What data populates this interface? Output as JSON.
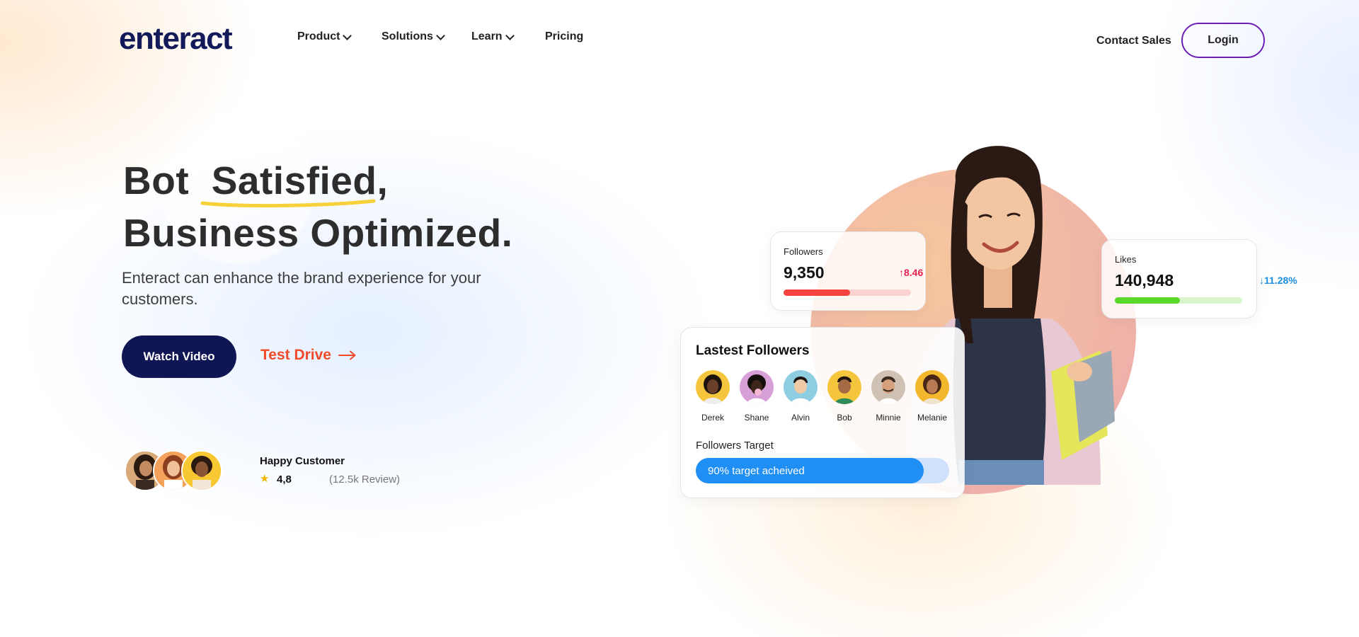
{
  "brand": {
    "logo_text": "enteract",
    "logo_color": "#131a5a"
  },
  "nav": {
    "items": [
      {
        "label": "Product",
        "has_dropdown": true
      },
      {
        "label": "Solutions",
        "has_dropdown": true
      },
      {
        "label": "Learn",
        "has_dropdown": true
      },
      {
        "label": "Pricing",
        "has_dropdown": false
      }
    ],
    "contact_label": "Contact Sales",
    "login_label": "Login",
    "login_border_color": "#6d1fb8"
  },
  "hero": {
    "title_line1_a": "Bot",
    "title_line1_b": "Satisfied,",
    "title_line2": "Business Optimized.",
    "underline_color": "#f7d13a",
    "subtitle": "Enteract can enhance the brand experience for your customers.",
    "watch_label": "Watch Video",
    "watch_color": "#101654",
    "testdrive_label": "Test Drive",
    "testdrive_icon": "arrow-right-icon",
    "testdrive_color": "#f04a2a"
  },
  "social_proof": {
    "label": "Happy Customer",
    "star_icon": "star-icon",
    "rating": "4,8",
    "reviews": "(12.5k Review)"
  },
  "stats": {
    "followers": {
      "label": "Followers",
      "value": "9,350",
      "change": "8.46",
      "direction": "up",
      "progress": 0.52,
      "color": "#f5433f",
      "track": "#fbd2cf",
      "change_color": "#e8214f"
    },
    "likes": {
      "label": "Likes",
      "value": "140,948",
      "change": "11.28%",
      "direction": "down",
      "progress": 0.51,
      "color": "#5ad92b",
      "track": "#d9f5cc",
      "change_color": "#1a8fe0"
    }
  },
  "latest_followers": {
    "title": "Lastest Followers",
    "people": [
      {
        "name": "Derek",
        "bg": "#f5c53e",
        "skin": "#6b4028",
        "hair": "#1c130e"
      },
      {
        "name": "Shane",
        "bg": "#d7a0d9",
        "skin": "#3b2619",
        "hair": "#15100c"
      },
      {
        "name": "Alvin",
        "bg": "#8fcde3",
        "skin": "#f0c9a6",
        "hair": "#1d1714"
      },
      {
        "name": "Bob",
        "bg": "#f5c53e",
        "skin": "#a46a44",
        "hair": "#20160f"
      },
      {
        "name": "Minnie",
        "bg": "#cfc2b5",
        "skin": "#d6a07c",
        "hair": "#3a2b22"
      },
      {
        "name": "Melanie",
        "bg": "#f2b72d",
        "skin": "#b77a52",
        "hair": "#4a2616"
      }
    ],
    "target_label": "Followers Target",
    "target_text": "90% target acheived",
    "target_progress": 0.9
  }
}
